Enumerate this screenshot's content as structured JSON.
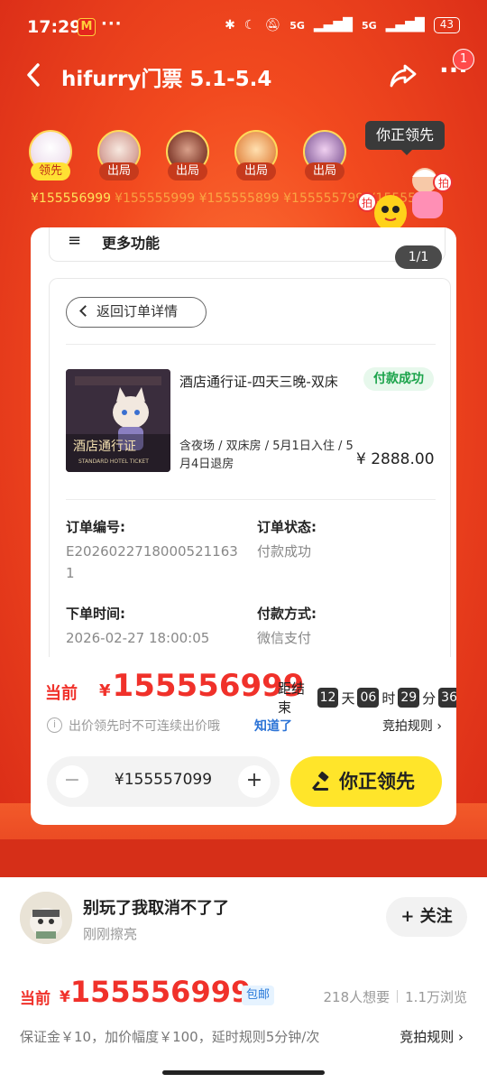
{
  "status_bar": {
    "time": "17:29",
    "app_badge": "M",
    "dots": "···",
    "signal1": "5G",
    "signal2": "5G",
    "battery": "43"
  },
  "header": {
    "title": "hifurry门票 5.1-5.4",
    "badge": "1",
    "more": "···"
  },
  "bidders": [
    {
      "tag": "领先",
      "amount": "¥155556999"
    },
    {
      "tag": "出局",
      "amount": "¥155555999"
    },
    {
      "tag": "出局",
      "amount": "¥155555899"
    },
    {
      "tag": "出局",
      "amount": "¥155555799"
    },
    {
      "tag": "出局",
      "amount": "¥155555..."
    }
  ],
  "bid_amounts_line": {
    "leader": "¥155556999",
    "rest": "¥155555999 ¥155555899 ¥155555799 ¥155555"
  },
  "leading_tip": "你正领先",
  "card": {
    "menu_icon": "≡",
    "more_functions": "更多功能",
    "page_indicator": "1/1",
    "return_label": "返回订单详情",
    "product": {
      "name": "酒店通行证-四天三晚-双床",
      "status": "付款成功",
      "spec": "含夜场 / 双床房 / 5月1日入住 / 5月4日退房",
      "price": "¥ 2888.00",
      "thumb_text": "酒店通行证",
      "thumb_sub": "STANDARD HOTEL TICKET"
    },
    "order": {
      "no_label": "订单编号:",
      "no_value": "E20260227180005211631",
      "state_label": "订单状态:",
      "state_value": "付款成功",
      "time_label": "下单时间:",
      "time_value": "2026-02-27 18:00:05",
      "pay_label": "付款方式:",
      "pay_value": "微信支付"
    },
    "current": {
      "label": "当前",
      "yen": "¥",
      "price": "155556999",
      "end_label": "距结束",
      "days": "12",
      "days_unit": "天",
      "hours": "06",
      "hours_unit": "时",
      "minutes": "29",
      "minutes_unit": "分",
      "seconds": "36"
    },
    "tip": {
      "icon": "i",
      "text": "出价领先时不可连续出价哦",
      "link": "知道了",
      "rules": "竞拍规则 ›"
    },
    "stepper": {
      "minus": "−",
      "value": "¥155557099",
      "plus": "+"
    },
    "bid_button": "你正领先"
  },
  "seller": {
    "name": "别玩了我取消不了了",
    "sub": "刚刚擦亮",
    "follow": "+ 关注"
  },
  "bottom_price": {
    "label": "当前",
    "yen": "¥",
    "price": "155556999",
    "shipping": "包邮",
    "wants": "218人想要",
    "views": "1.1万浏览"
  },
  "bottom_rules": {
    "text": "保证金￥10，加价幅度￥100，延时规则5分钟/次",
    "link": "竞拍规则 ›"
  },
  "colors": {
    "accent_red": "#f0312a",
    "button_yellow": "#ffe52a",
    "success_green": "#1aa34a",
    "link_blue": "#2b73d6"
  }
}
